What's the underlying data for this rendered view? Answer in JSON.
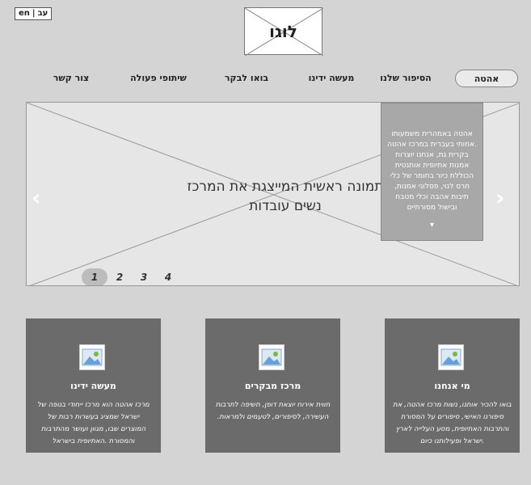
{
  "lang": {
    "en": "en",
    "sep": "|",
    "he": "עב"
  },
  "logo": {
    "text": "לוגו"
  },
  "nav": [
    {
      "label": "אהטה",
      "active": true
    },
    {
      "label": "הסיפור שלנו",
      "active": false
    },
    {
      "label": "מעשה ידינו",
      "active": false
    },
    {
      "label": "בואו לבקר",
      "active": false
    },
    {
      "label": "שיתופי פעולה",
      "active": false
    },
    {
      "label": "צור קשר",
      "active": false
    }
  ],
  "hero": {
    "title_line1": "תמונה ראשית המייצגת את המרכז",
    "title_line2": "נשים עובדות",
    "info_text": "אהטה באמהרית משמעותו .אחותי בעברית במרכז אהטה בקרית גת, אנחנו יוצרות אמנות אתיופית אותנטית הכוללת כיור בחומר של כלי חרס לנוי, פסלוני אמנות, תיבות אהבה וכלי מטבח ובישול מסורתיים",
    "prev": "‹",
    "next": "›",
    "info_chevron": "▾",
    "pages": [
      "1",
      "2",
      "3",
      "4"
    ],
    "active_page": "1"
  },
  "cards": [
    {
      "title": "מי אנחנו",
      "desc": "בואו להכיר אותנו, נשות מרכז אהטה, את סיפורנו האישי, סיפורים על המסורת והתרבות האתיופית, מסע העלייה לארץ .ישראל ופעילותנו כיום",
      "icon": "image-placeholder-icon"
    },
    {
      "title": "מרכז מבקרים",
      "desc": "חווית אירוח יוצאת דופן, חשיפה לתרבות העשירה, לסיפורים, לטעמים ולמראות.",
      "icon": "image-placeholder-icon"
    },
    {
      "title": "מעשה ידינו",
      "desc": "מרכז אהטה הוא מרכז ייחודי בנופה של ישראל שמציג בעשרות רבות של המוצרים שבו, מגוון ועושר מהתרבות והמסורת .האתיופית בישראל",
      "icon": "image-placeholder-icon"
    }
  ]
}
